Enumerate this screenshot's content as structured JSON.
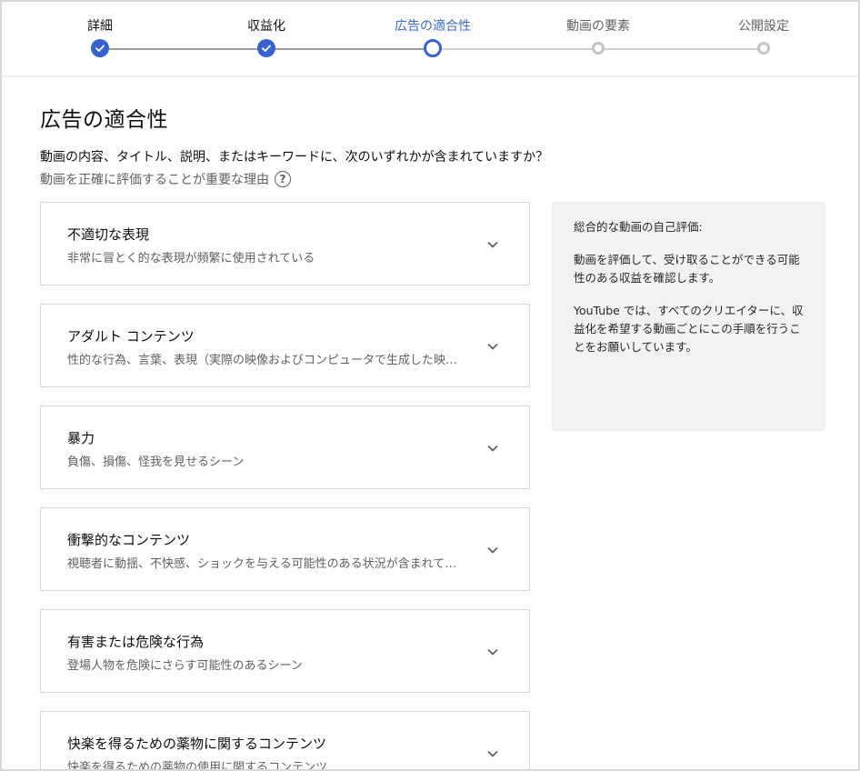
{
  "stepper": {
    "steps": [
      {
        "label": "詳細",
        "state": "done"
      },
      {
        "label": "収益化",
        "state": "done"
      },
      {
        "label": "広告の適合性",
        "state": "active"
      },
      {
        "label": "動画の要素",
        "state": "todo"
      },
      {
        "label": "公開設定",
        "state": "todo"
      }
    ]
  },
  "main": {
    "title": "広告の適合性",
    "question": "動画の内容、タイトル、説明、またはキーワードに、次のいずれかが含まれていますか？",
    "reason_link": "動画を正確に評価することが重要な理由"
  },
  "categories": [
    {
      "title": "不適切な表現",
      "desc": "非常に冒とく的な表現が頻繁に使用されている"
    },
    {
      "title": "アダルト コンテンツ",
      "desc": "性的な行為、言葉、表現（実際の映像およびコンピュータで生成した映像..."
    },
    {
      "title": "暴力",
      "desc": "負傷、損傷、怪我を見せるシーン"
    },
    {
      "title": "衝撃的なコンテンツ",
      "desc": "視聴者に動揺、不快感、ショックを与える可能性のある状況が含まれてい..."
    },
    {
      "title": "有害または危険な行為",
      "desc": "登場人物を危険にさらす可能性のあるシーン"
    },
    {
      "title": "快楽を得るための薬物に関するコンテンツ",
      "desc": "快楽を得るための薬物の使用に関するコンテンツ"
    }
  ],
  "side_panel": {
    "heading": "総合的な動画の自己評価:",
    "para1": "動画を評価して、受け取ることができる可能性のある収益を確認します。",
    "para2": "YouTube では、すべてのクリエイターに、収益化を希望する動画ごとにこの手順を行うことをお願いしています。"
  },
  "colors": {
    "accent": "#3663d1",
    "active_label": "#3b6ad6",
    "muted_text": "#606060",
    "inactive_step": "#c4c4c4",
    "panel_bg": "#f2f2f2"
  },
  "icons": {
    "done_step": "check-icon",
    "help": "help-circle-icon",
    "expand": "chevron-down-icon"
  }
}
